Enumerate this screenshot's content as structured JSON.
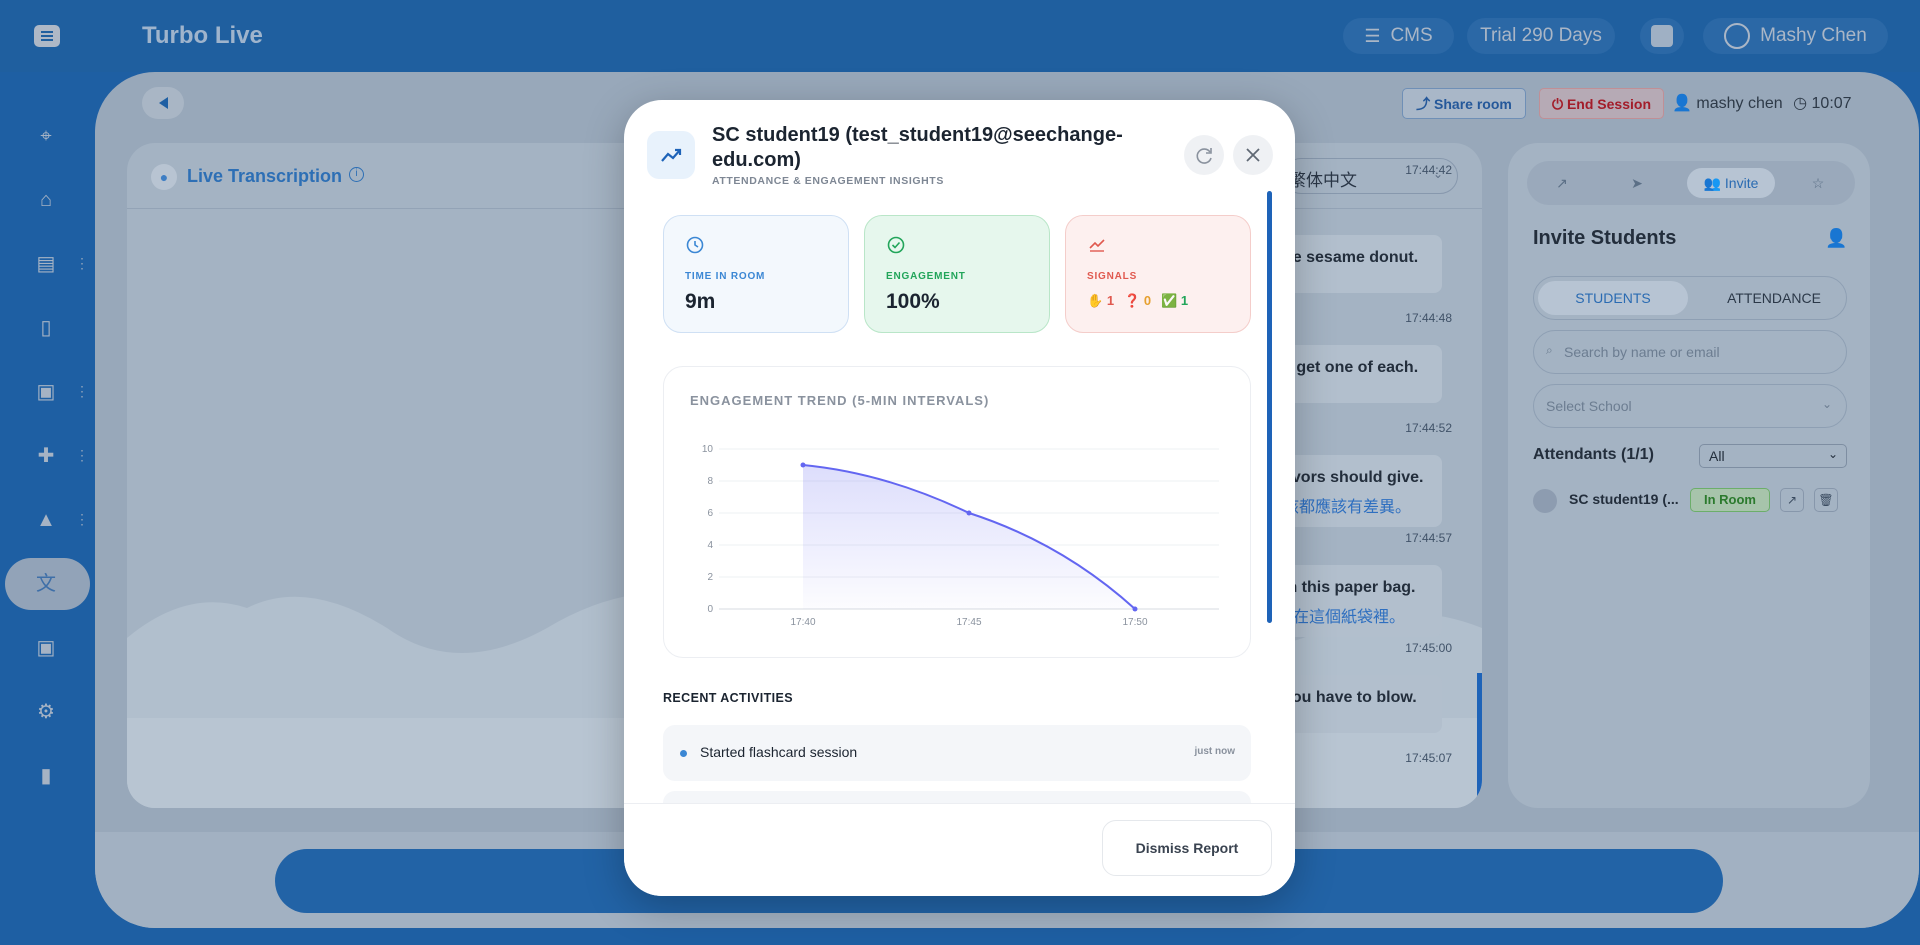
{
  "header": {
    "app_title": "Turbo Live",
    "cms_label": "CMS",
    "trial_label": "Trial 290 Days",
    "user_name": "Mashy Chen"
  },
  "session": {
    "share_label": "Share room",
    "end_label": "End Session",
    "host_name": "mashy chen",
    "clock": "10:07"
  },
  "transcription": {
    "title": "Live Transcription",
    "language": "繁体中文",
    "messages": [
      {
        "text": "he sesame donut.",
        "zh": "",
        "time": "17:44:48"
      },
      {
        "text": "a get one of each.",
        "zh": "",
        "time": "17:44:52"
      },
      {
        "text": "avors should give.",
        "zh": "該都應該有差異。",
        "time": "17:44:57"
      },
      {
        "text": "In this paper bag.",
        "zh": "• 在這個紙袋裡。",
        "time": "17:45:00"
      },
      {
        "text": "you have to blow.",
        "zh": "",
        "time": "17:45:07"
      }
    ],
    "partial_time": "17:44:42"
  },
  "right_panel": {
    "tab_invite": "Invite",
    "title": "Invite Students",
    "seg_students": "STUDENTS",
    "seg_attendance": "ATTENDANCE",
    "search_placeholder": "Search by name or email",
    "school_placeholder": "Select School",
    "attendants_label": "Attendants (1/1)",
    "filter_value": "All",
    "student_name": "SC student19 (...",
    "student_status": "In Room"
  },
  "modal": {
    "title": "SC student19 (test_student19@seechange-edu.com)",
    "subtitle": "ATTENDANCE & ENGAGEMENT INSIGHTS",
    "stats": {
      "time_label": "TIME IN ROOM",
      "time_value": "9m",
      "engagement_label": "ENGAGEMENT",
      "engagement_value": "100%",
      "signals_label": "SIGNALS",
      "signal_hand": "1",
      "signal_question": "0",
      "signal_check": "1"
    },
    "chart_title": "ENGAGEMENT TREND (5-MIN INTERVALS)",
    "recent_title": "RECENT ACTIVITIES",
    "activities": [
      {
        "text": "Started flashcard session",
        "time": "just now"
      }
    ],
    "dismiss_label": "Dismiss Report"
  },
  "chart_data": {
    "type": "area",
    "title": "ENGAGEMENT TREND (5-MIN INTERVALS)",
    "x": [
      "17:40",
      "17:45",
      "17:50"
    ],
    "values": [
      9,
      6,
      0
    ],
    "yticks": [
      0,
      2,
      4,
      6,
      8,
      10
    ],
    "ylim": [
      0,
      10
    ],
    "grid": true,
    "color": "#6366f1"
  },
  "colors": {
    "brand": "#1e5fa3",
    "accent": "#1e63b8",
    "end_session": "#a31d2a",
    "engagement_green": "#22a55a",
    "signals_red": "#e0594f"
  }
}
